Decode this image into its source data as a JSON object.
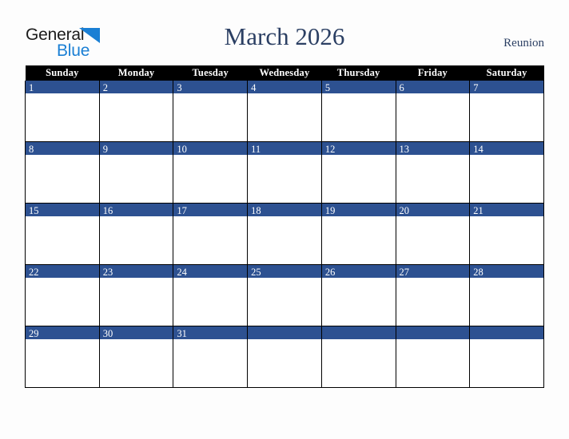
{
  "brand": {
    "word1": "General",
    "word2": "Blue",
    "triangle_color": "#1a7fd4",
    "word1_color": "#1c1c1c",
    "word2_color": "#1a7fd4"
  },
  "header": {
    "title": "March 2026",
    "locale": "Reunion",
    "title_color": "#2b3f63"
  },
  "calendar": {
    "month": "March",
    "year": "2026",
    "header_bg": "#000000",
    "header_fg": "#ffffff",
    "daynum_bg": "#2d5191",
    "daynum_fg": "#ffffff",
    "cell_bg": "#ffffff",
    "grid_line": "#000000",
    "weekdays": [
      "Sunday",
      "Monday",
      "Tuesday",
      "Wednesday",
      "Thursday",
      "Friday",
      "Saturday"
    ],
    "weeks": [
      [
        "1",
        "2",
        "3",
        "4",
        "5",
        "6",
        "7"
      ],
      [
        "8",
        "9",
        "10",
        "11",
        "12",
        "13",
        "14"
      ],
      [
        "15",
        "16",
        "17",
        "18",
        "19",
        "20",
        "21"
      ],
      [
        "22",
        "23",
        "24",
        "25",
        "26",
        "27",
        "28"
      ],
      [
        "29",
        "30",
        "31",
        "",
        "",
        "",
        ""
      ]
    ]
  }
}
